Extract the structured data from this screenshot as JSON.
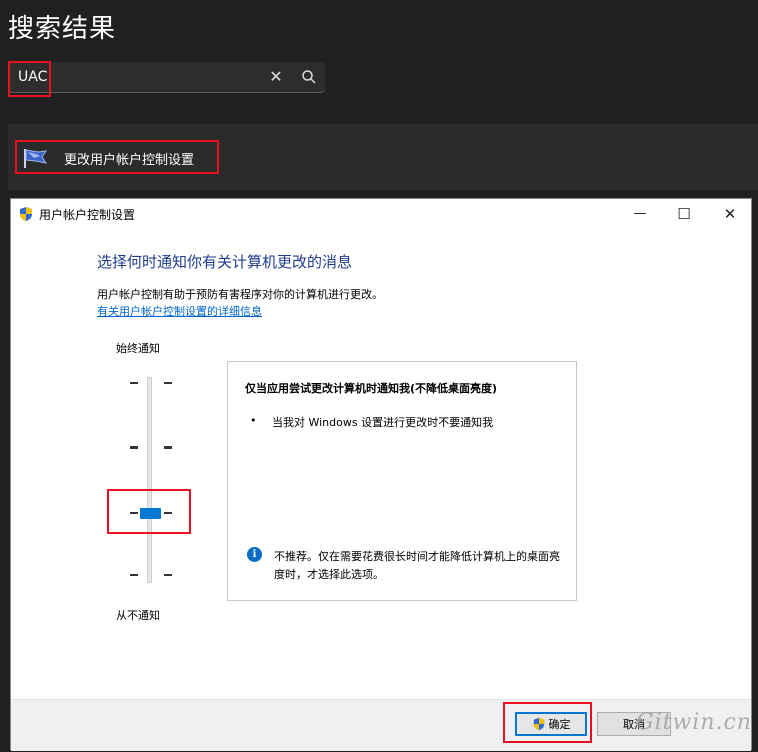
{
  "search": {
    "title": "搜索结果",
    "query": "UAC",
    "clear_glyph": "✕"
  },
  "results": [
    {
      "label": "更改用户帐户控制设置",
      "icon": "uac-flag-icon"
    }
  ],
  "dialog": {
    "title": "用户帐户控制设置",
    "window_buttons": {
      "minimize": "—",
      "maximize": "☐",
      "close": "✕"
    },
    "heading": "选择何时通知你有关计算机更改的消息",
    "description": "用户帐户控制有助于预防有害程序对你的计算机进行更改。",
    "link": "有关用户帐户控制设置的详细信息",
    "slider": {
      "top_label": "始终通知",
      "bottom_label": "从不通知",
      "levels": 4,
      "selected_level": 3
    },
    "info": {
      "title": "仅当应用尝试更改计算机时通知我(不降低桌面亮度)",
      "bullet": "当我对 Windows 设置进行更改时不要通知我",
      "note_icon": "i",
      "note": "不推荐。仅在需要花费很长时间才能降低计算机上的桌面亮度时，才选择此选项。"
    },
    "buttons": {
      "ok": "确定",
      "cancel": "取消"
    }
  },
  "watermark": "Gitwin.cn",
  "colors": {
    "highlight": "#e81123",
    "accent": "#0078d4",
    "heading": "#1e3c8c",
    "link": "#0066cc",
    "dark_bg": "#202020"
  }
}
